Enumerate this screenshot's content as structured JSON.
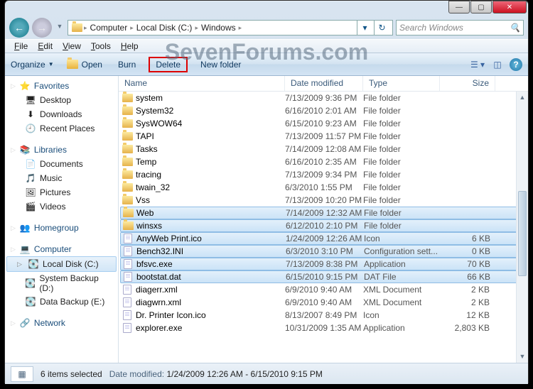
{
  "watermark": "SevenForums.com",
  "titlebar": {
    "min": "—",
    "max": "▢",
    "close": "✕"
  },
  "nav": {
    "crumbs": [
      "Computer",
      "Local Disk (C:)",
      "Windows"
    ],
    "refresh": "↻",
    "search_placeholder": "Search Windows"
  },
  "menu": [
    "File",
    "Edit",
    "View",
    "Tools",
    "Help"
  ],
  "toolbar": {
    "organize": "Organize",
    "open": "Open",
    "burn": "Burn",
    "delete": "Delete",
    "newfolder": "New folder",
    "help": "?"
  },
  "sidebar": {
    "favorites": {
      "label": "Favorites",
      "items": [
        "Desktop",
        "Downloads",
        "Recent Places"
      ]
    },
    "libraries": {
      "label": "Libraries",
      "items": [
        "Documents",
        "Music",
        "Pictures",
        "Videos"
      ]
    },
    "homegroup": {
      "label": "Homegroup"
    },
    "computer": {
      "label": "Computer",
      "items": [
        "Local Disk (C:)",
        "System Backup (D:)",
        "Data Backup (E:)"
      ],
      "selected": 0
    },
    "network": {
      "label": "Network"
    }
  },
  "columns": {
    "name": "Name",
    "date": "Date modified",
    "type": "Type",
    "size": "Size"
  },
  "files": [
    {
      "n": "system",
      "d": "7/13/2009 9:36 PM",
      "t": "File folder",
      "s": "",
      "k": "folder"
    },
    {
      "n": "System32",
      "d": "6/16/2010 2:01 AM",
      "t": "File folder",
      "s": "",
      "k": "folder"
    },
    {
      "n": "SysWOW64",
      "d": "6/15/2010 9:23 AM",
      "t": "File folder",
      "s": "",
      "k": "folder"
    },
    {
      "n": "TAPI",
      "d": "7/13/2009 11:57 PM",
      "t": "File folder",
      "s": "",
      "k": "folder"
    },
    {
      "n": "Tasks",
      "d": "7/14/2009 12:08 AM",
      "t": "File folder",
      "s": "",
      "k": "folder"
    },
    {
      "n": "Temp",
      "d": "6/16/2010 2:35 AM",
      "t": "File folder",
      "s": "",
      "k": "folder"
    },
    {
      "n": "tracing",
      "d": "7/13/2009 9:34 PM",
      "t": "File folder",
      "s": "",
      "k": "folder"
    },
    {
      "n": "twain_32",
      "d": "6/3/2010 1:55 PM",
      "t": "File folder",
      "s": "",
      "k": "folder"
    },
    {
      "n": "Vss",
      "d": "7/13/2009 10:20 PM",
      "t": "File folder",
      "s": "",
      "k": "folder"
    },
    {
      "n": "Web",
      "d": "7/14/2009 12:32 AM",
      "t": "File folder",
      "s": "",
      "k": "folder",
      "sel": true
    },
    {
      "n": "winsxs",
      "d": "6/12/2010 2:10 PM",
      "t": "File folder",
      "s": "",
      "k": "folder",
      "sel": true
    },
    {
      "n": "AnyWeb Print.ico",
      "d": "1/24/2009 12:26 AM",
      "t": "Icon",
      "s": "6 KB",
      "k": "file",
      "sel": true
    },
    {
      "n": "Bench32.INI",
      "d": "6/3/2010 3:10 PM",
      "t": "Configuration sett...",
      "s": "0 KB",
      "k": "file",
      "sel": true
    },
    {
      "n": "bfsvc.exe",
      "d": "7/13/2009 8:38 PM",
      "t": "Application",
      "s": "70 KB",
      "k": "file",
      "sel": true
    },
    {
      "n": "bootstat.dat",
      "d": "6/15/2010 9:15 PM",
      "t": "DAT File",
      "s": "66 KB",
      "k": "file",
      "sel": true
    },
    {
      "n": "diagerr.xml",
      "d": "6/9/2010 9:40 AM",
      "t": "XML Document",
      "s": "2 KB",
      "k": "file"
    },
    {
      "n": "diagwrn.xml",
      "d": "6/9/2010 9:40 AM",
      "t": "XML Document",
      "s": "2 KB",
      "k": "file"
    },
    {
      "n": "Dr. Printer Icon.ico",
      "d": "8/13/2007 8:49 PM",
      "t": "Icon",
      "s": "12 KB",
      "k": "file"
    },
    {
      "n": "explorer.exe",
      "d": "10/31/2009 1:35 AM",
      "t": "Application",
      "s": "2,803 KB",
      "k": "file"
    }
  ],
  "status": {
    "count": "6 items selected",
    "label": "Date modified:",
    "value": "1/24/2009 12:26 AM - 6/15/2010 9:15 PM"
  }
}
